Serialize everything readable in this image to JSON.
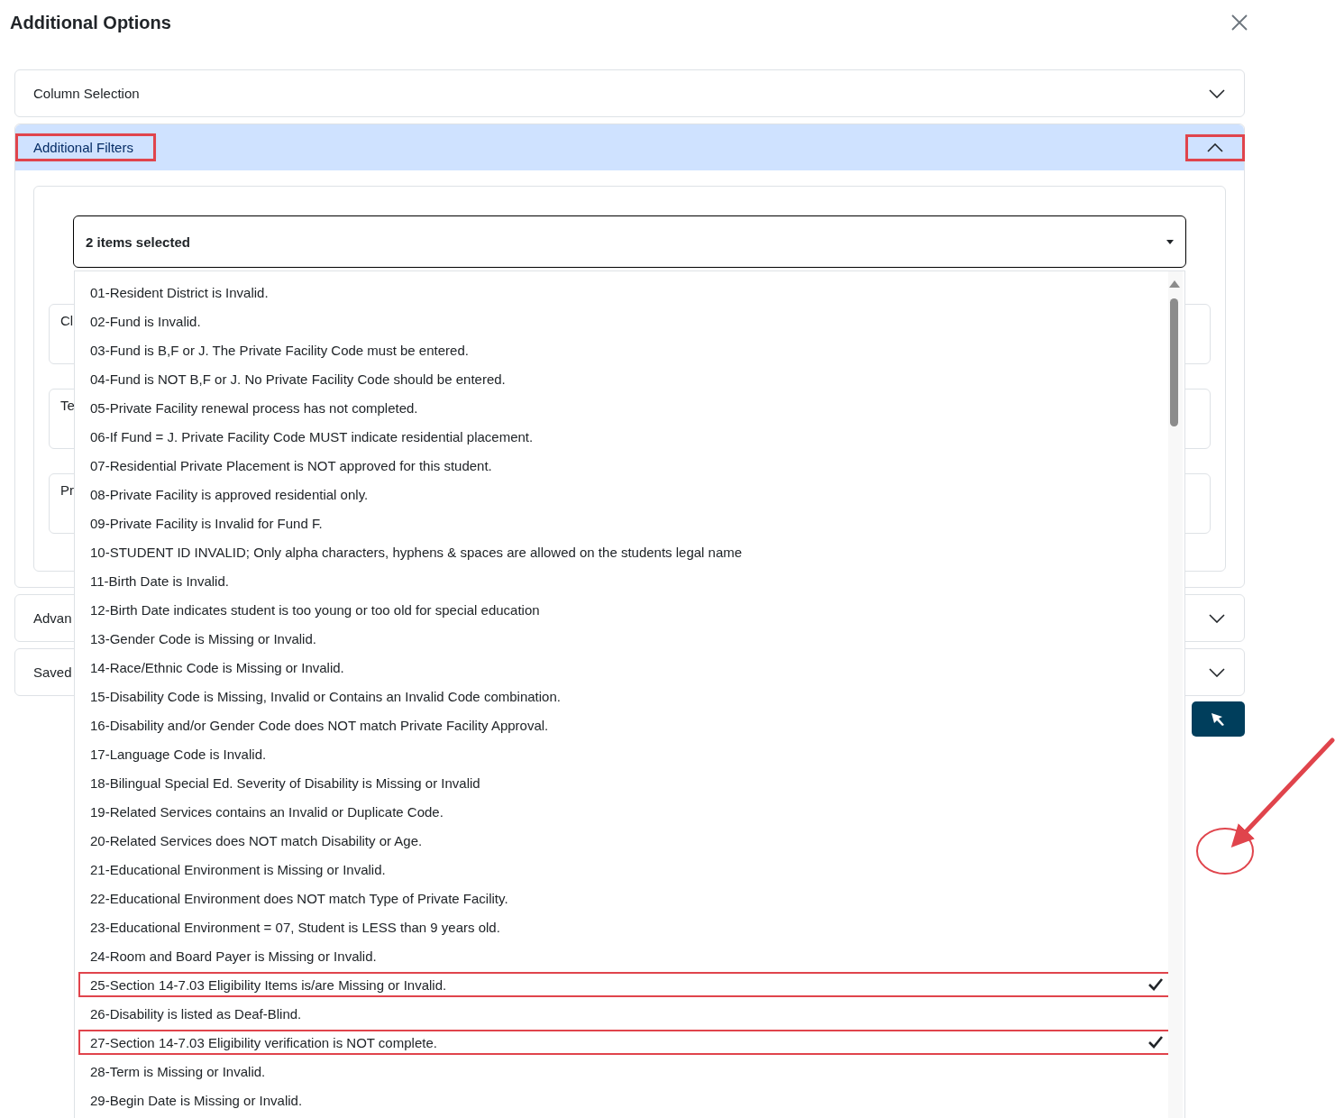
{
  "dialog": {
    "title": "Additional Options"
  },
  "accordion": [
    {
      "label": "Column Selection",
      "expanded": false,
      "highlighted": false
    },
    {
      "label": "Additional Filters",
      "expanded": true,
      "highlighted": true,
      "fields": [
        "Cl",
        "Te",
        "Pr"
      ],
      "multiselect": {
        "value": "2 items selected",
        "options": [
          {
            "label": "01-Resident District is Invalid.",
            "selected": false
          },
          {
            "label": "02-Fund is Invalid.",
            "selected": false
          },
          {
            "label": "03-Fund is B,F or J. The Private Facility Code must be entered.",
            "selected": false
          },
          {
            "label": "04-Fund is NOT B,F or J. No Private Facility Code should be entered.",
            "selected": false
          },
          {
            "label": "05-Private Facility renewal process has not completed.",
            "selected": false
          },
          {
            "label": "06-If Fund = J. Private Facility Code MUST indicate residential placement.",
            "selected": false
          },
          {
            "label": "07-Residential Private Placement is NOT approved for this student.",
            "selected": false
          },
          {
            "label": "08-Private Facility is approved residential only.",
            "selected": false
          },
          {
            "label": "09-Private Facility is Invalid for Fund F.",
            "selected": false
          },
          {
            "label": "10-STUDENT ID INVALID; Only alpha characters, hyphens & spaces are allowed on the students legal name",
            "selected": false
          },
          {
            "label": "11-Birth Date is Invalid.",
            "selected": false
          },
          {
            "label": "12-Birth Date indicates student is too young or too old for special education",
            "selected": false
          },
          {
            "label": "13-Gender Code is Missing or Invalid.",
            "selected": false
          },
          {
            "label": "14-Race/Ethnic Code is Missing or Invalid.",
            "selected": false
          },
          {
            "label": "15-Disability Code is Missing, Invalid or Contains an Invalid Code combination.",
            "selected": false
          },
          {
            "label": "16-Disability and/or Gender Code does NOT match Private Facility Approval.",
            "selected": false
          },
          {
            "label": "17-Language Code is Invalid.",
            "selected": false
          },
          {
            "label": "18-Bilingual Special Ed. Severity of Disability is Missing or Invalid",
            "selected": false
          },
          {
            "label": "19-Related Services contains an Invalid or Duplicate Code.",
            "selected": false
          },
          {
            "label": "20-Related Services does NOT match Disability or Age.",
            "selected": false
          },
          {
            "label": "21-Educational Environment is Missing or Invalid.",
            "selected": false
          },
          {
            "label": "22-Educational Environment does NOT match Type of Private Facility.",
            "selected": false
          },
          {
            "label": "23-Educational Environment = 07, Student is LESS than 9 years old.",
            "selected": false
          },
          {
            "label": "24-Room and Board Payer is Missing or Invalid.",
            "selected": false
          },
          {
            "label": "25-Section 14-7.03 Eligibility Items is/are Missing or Invalid.",
            "selected": true
          },
          {
            "label": "26-Disability is listed as Deaf-Blind.",
            "selected": false
          },
          {
            "label": "27-Section 14-7.03 Eligibility verification is NOT complete.",
            "selected": true
          },
          {
            "label": "28-Term is Missing or Invalid.",
            "selected": false
          },
          {
            "label": "29-Begin Date is Missing or Invalid.",
            "selected": false
          }
        ]
      }
    },
    {
      "label": "Advan",
      "expanded": false,
      "highlighted": false
    },
    {
      "label": "Saved",
      "expanded": false,
      "highlighted": false
    }
  ],
  "annotations": {
    "arrow": true,
    "circle": true
  }
}
